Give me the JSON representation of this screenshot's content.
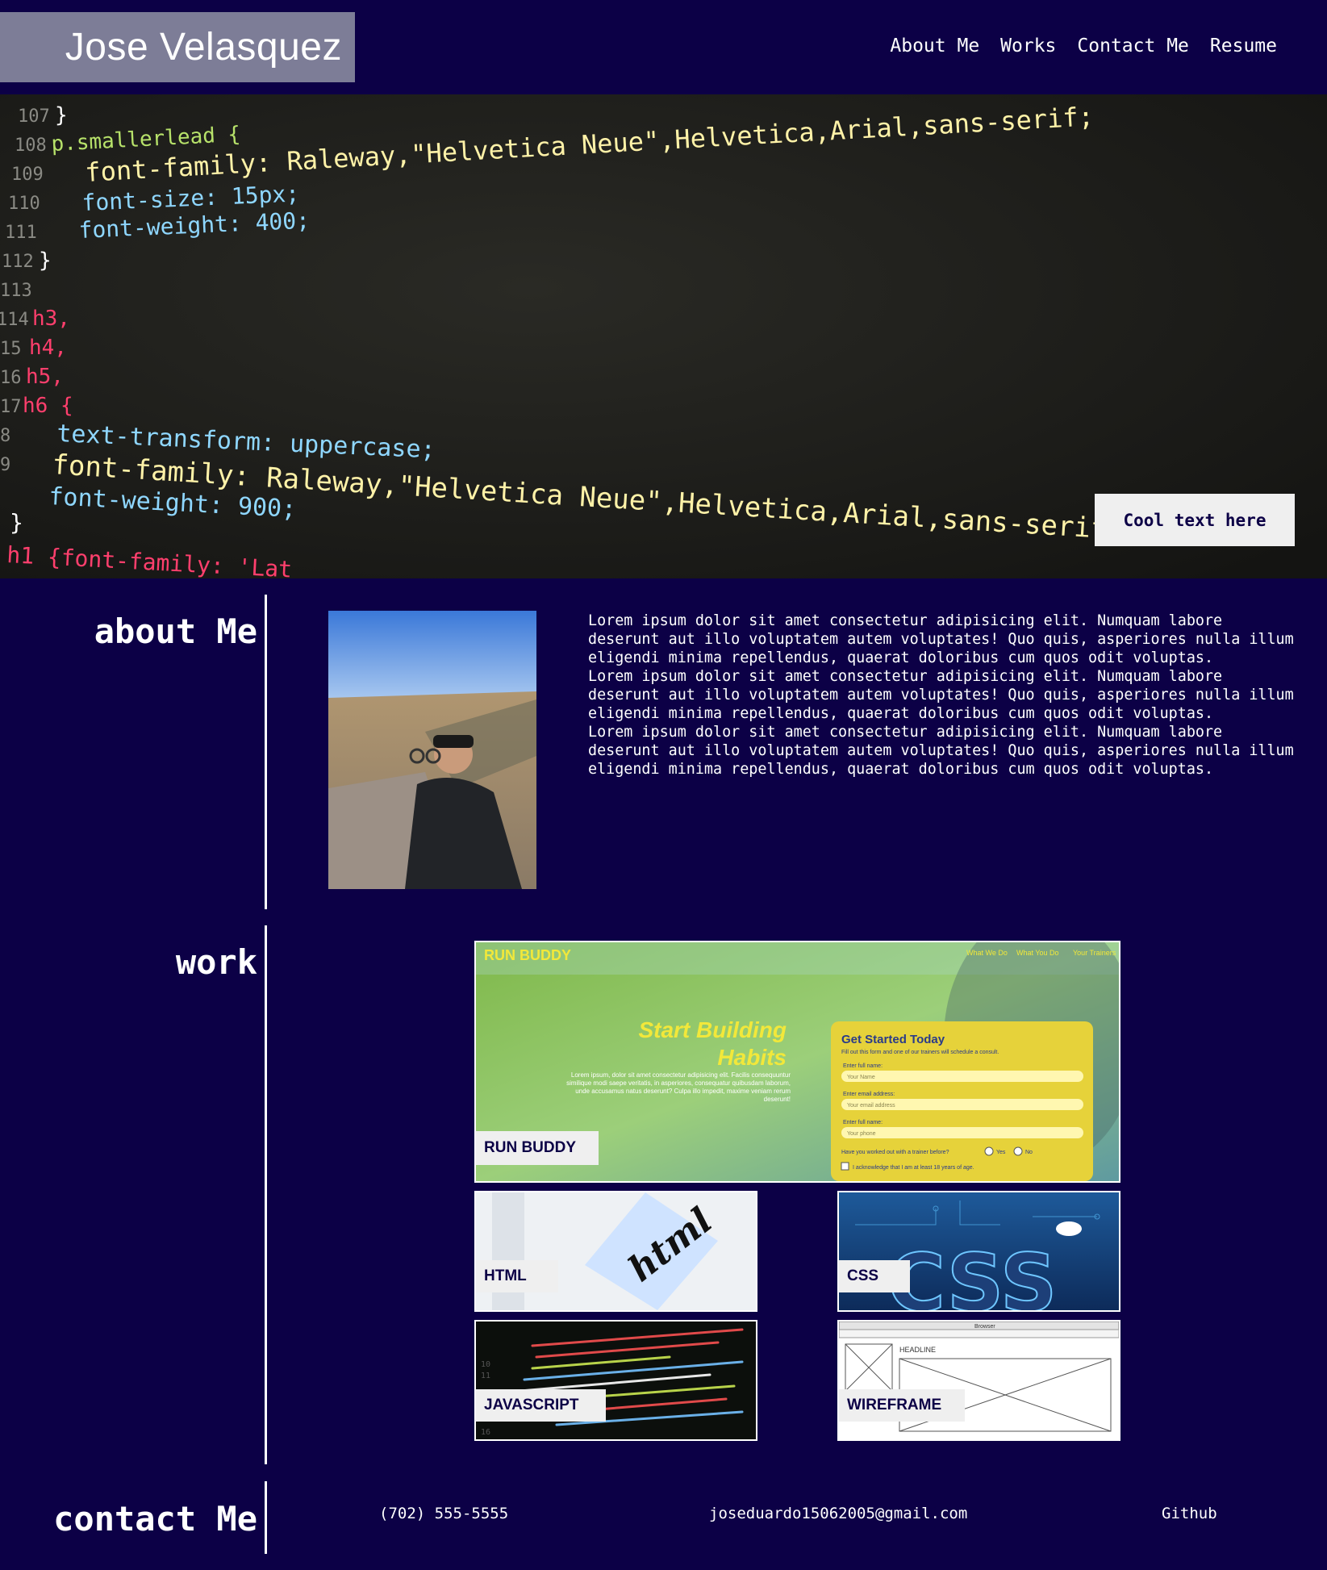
{
  "header": {
    "name": "Jose Velasquez",
    "nav": [
      "About Me",
      "Works",
      "Contact Me",
      "Resume"
    ]
  },
  "hero": {
    "button_label": "Cool text here",
    "code_lines": [
      {
        "num": "107",
        "text": "}"
      },
      {
        "num": "108",
        "text": "p.smallerlead {"
      },
      {
        "num": "109",
        "text": "font-family: Raleway,\"Helvetica Neue\",Helvetica,Arial,sans-serif;"
      },
      {
        "num": "110",
        "text": "font-size: 15px;"
      },
      {
        "num": "111",
        "text": "font-weight: 400;"
      },
      {
        "num": "112",
        "text": "}"
      },
      {
        "num": "113",
        "text": ""
      },
      {
        "num": "114",
        "text": "h3,"
      },
      {
        "num": "15",
        "text": "h4,"
      },
      {
        "num": "16",
        "text": "h5,"
      },
      {
        "num": "17",
        "text": "h6 {"
      },
      {
        "num": "8",
        "text": "text-transform: uppercase;"
      },
      {
        "num": "9",
        "text": "font-family: Raleway,\"Helvetica Neue\",Helvetica,Arial,sans-serif;"
      },
      {
        "num": "",
        "text": "font-weight: 900;"
      },
      {
        "num": "",
        "text": "}"
      },
      {
        "num": "",
        "text": "h1 {font-family: 'Lat"
      }
    ]
  },
  "about": {
    "title": "about Me",
    "paragraphs": [
      "Lorem ipsum dolor sit amet consectetur adipisicing elit. Numquam labore deserunt aut illo voluptatem autem voluptates! Quo quis, asperiores nulla illum eligendi minima repellendus, quaerat doloribus cum quos odit voluptas.",
      "Lorem ipsum dolor sit amet consectetur adipisicing elit. Numquam labore deserunt aut illo voluptatem autem voluptates! Quo quis, asperiores nulla illum eligendi minima repellendus, quaerat doloribus cum quos odit voluptas.",
      "Lorem ipsum dolor sit amet consectetur adipisicing elit. Numquam labore deserunt aut illo voluptatem autem voluptates! Quo quis, asperiores nulla illum eligendi minima repellendus, quaerat doloribus cum quos odit voluptas."
    ]
  },
  "work": {
    "title": "work",
    "projects": [
      {
        "label": "RUN BUDDY"
      },
      {
        "label": "HTML"
      },
      {
        "label": "CSS"
      },
      {
        "label": "JAVASCRIPT"
      },
      {
        "label": "WIREFRAME"
      }
    ],
    "runbuddy_preview": {
      "brand": "RUN BUDDY",
      "nav": [
        "What We Do",
        "What You Do",
        "Your Trainers"
      ],
      "headline_1": "Start Building",
      "headline_2": "Habits",
      "blurb": "Lorem ipsum, dolor sit amet consectetur adipisicing elit. Facilis consequuntur similique modi saepe veritatis, in asperiores, consequatur quibusdam laborum, unde accusamus natus deserunt? Culpa illo impedit, maxime veniam rerum deserunt!",
      "form_title": "Get Started Today",
      "form_sub": "Fill out this form and one of our trainers will schedule a consult.",
      "field1_label": "Enter full name:",
      "field1_ph": "Your Name",
      "field2_label": "Enter email address:",
      "field2_ph": "Your email address",
      "field3_label": "Enter full name:",
      "field3_ph": "Your phone",
      "question": "Have you worked out with a trainer before?",
      "yes": "Yes",
      "no": "No",
      "ack": "I acknowledge that I am at least 18 years of age."
    },
    "html_note": "html",
    "css_text": "CSS",
    "wireframe_headline": "HEADLINE",
    "wireframe_browser": "Browser"
  },
  "contact": {
    "title": "contact Me",
    "phone": "(702) 555-5555",
    "email": "joseduardo15062005@gmail.com",
    "github": "Github"
  }
}
